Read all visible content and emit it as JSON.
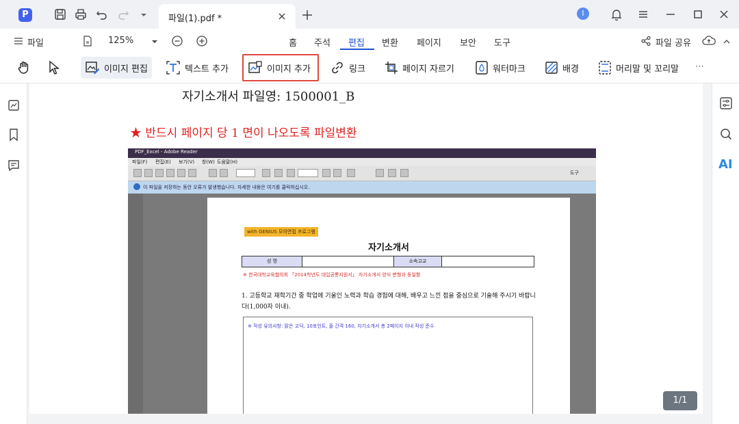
{
  "app": {
    "logo_glyph": "P",
    "tab_title": "파일(1).pdf *",
    "user_initial": "I"
  },
  "menu": {
    "file_label": "파일",
    "zoom": "125%",
    "share_label": "파일 공유"
  },
  "nav_tabs": [
    {
      "label": "홈"
    },
    {
      "label": "주석"
    },
    {
      "label": "편집"
    },
    {
      "label": "변환"
    },
    {
      "label": "페이지"
    },
    {
      "label": "보안"
    },
    {
      "label": "도구"
    }
  ],
  "active_tab": "편집",
  "toolbar": {
    "image_edit": "이미지 편집",
    "text_add": "텍스트 추가",
    "image_add": "이미지 추가",
    "link": "링크",
    "crop_page": "페이지 자르기",
    "watermark": "워터마크",
    "background": "배경",
    "header_footer": "머리말 및 꼬리말",
    "more": "⋯"
  },
  "document": {
    "line1": "자기소개서 파일영: 1500001_B",
    "line2": "★ 반드시 페이지 당 1 면이 나오도록 파일변환",
    "embedded": {
      "window_title": "PDF_Excel - Adobe Reader",
      "menu_items": [
        "파일(F)",
        "편집(E)",
        "보기(V)",
        "창(W)",
        "도움말(H)"
      ],
      "tools_label": "도구",
      "info_bar": "이 파일을 저장하는 동안 오류가 발생했습니다. 자세한 내용은 여기를 클릭하십시오.",
      "genius_tag": "with GENIUS 모의면접 프로그램",
      "paper_title": "자기소개서",
      "table": {
        "name_header": "성 명",
        "school_header": "소속고교"
      },
      "red_note": "※ 한국대학교육협의회 「2014학년도 대입공통지원서」 자기소개서 양식 변형과 동일함",
      "question_1": "1. 고등학교 재학기간 중 학업에 기울인 노력과 학습 경험에 대해, 배우고 느낀 점을 중심으로 기술해 주시기 바랍니다(1,000자 이내).",
      "answer_hint": "※ 작성 유의사항: 맑은 고딕, 10포인트, 줄 간격 160, 자기소개서 총 2페이지 이내 작성 준수"
    }
  },
  "page_indicator": "1/1",
  "ai_label": "AI",
  "colors": {
    "accent": "#1e50d6",
    "highlight_border": "#e0463c",
    "red_text": "#e02020"
  }
}
